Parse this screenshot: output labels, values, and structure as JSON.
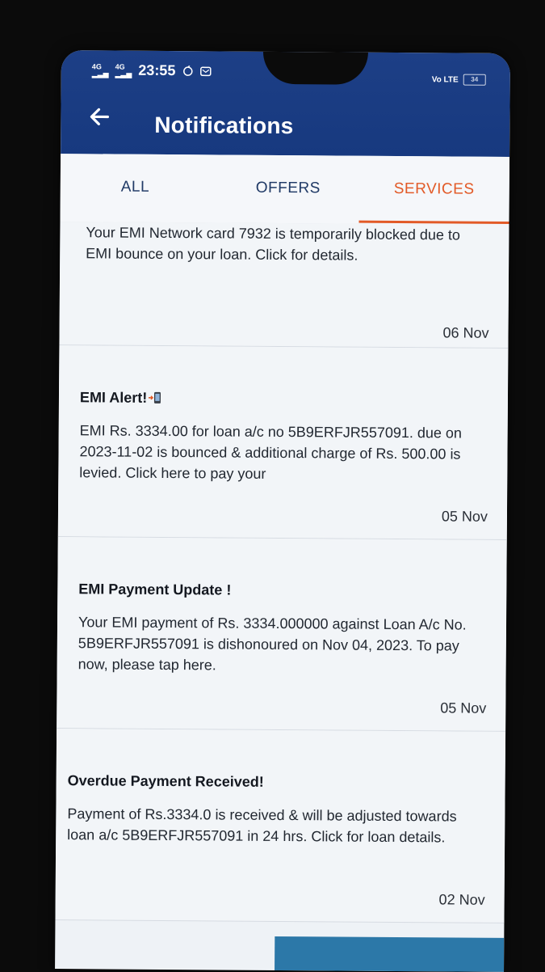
{
  "status": {
    "net1": "4G",
    "net2": "4G",
    "time": "23:55",
    "battery": "34",
    "volte": "Vo LTE"
  },
  "header": {
    "title": "Notifications"
  },
  "tabs": [
    {
      "label": "ALL"
    },
    {
      "label": "OFFERS"
    },
    {
      "label": "SERVICES",
      "active": true
    }
  ],
  "notifications": [
    {
      "heading": "",
      "body": "Your EMI Network card  7932 is temporarily blocked due to EMI bounce on your loan. Click for details.",
      "date": "06 Nov"
    },
    {
      "heading": "EMI Alert!",
      "body": "EMI Rs. 3334.00 for loan a/c no 5B9ERFJR557091. due on 2023-11-02 is bounced & additional charge of Rs. 500.00 is levied. Click here to pay your",
      "date": "05 Nov"
    },
    {
      "heading": "EMI Payment Update !",
      "body": "Your EMI payment of Rs. 3334.000000  against Loan A/c No. 5B9ERFJR557091 is dishonoured on Nov 04, 2023. To pay now, please tap here.",
      "date": "05 Nov"
    },
    {
      "heading": "Overdue Payment Received!",
      "body": "Payment of Rs.3334.0  is received & will be adjusted towards loan a/c 5B9ERFJR557091  in 24 hrs. Click for loan details.",
      "date": "02 Nov"
    }
  ],
  "colors": {
    "appbar": "#1d3f86",
    "accent": "#e25a27"
  }
}
